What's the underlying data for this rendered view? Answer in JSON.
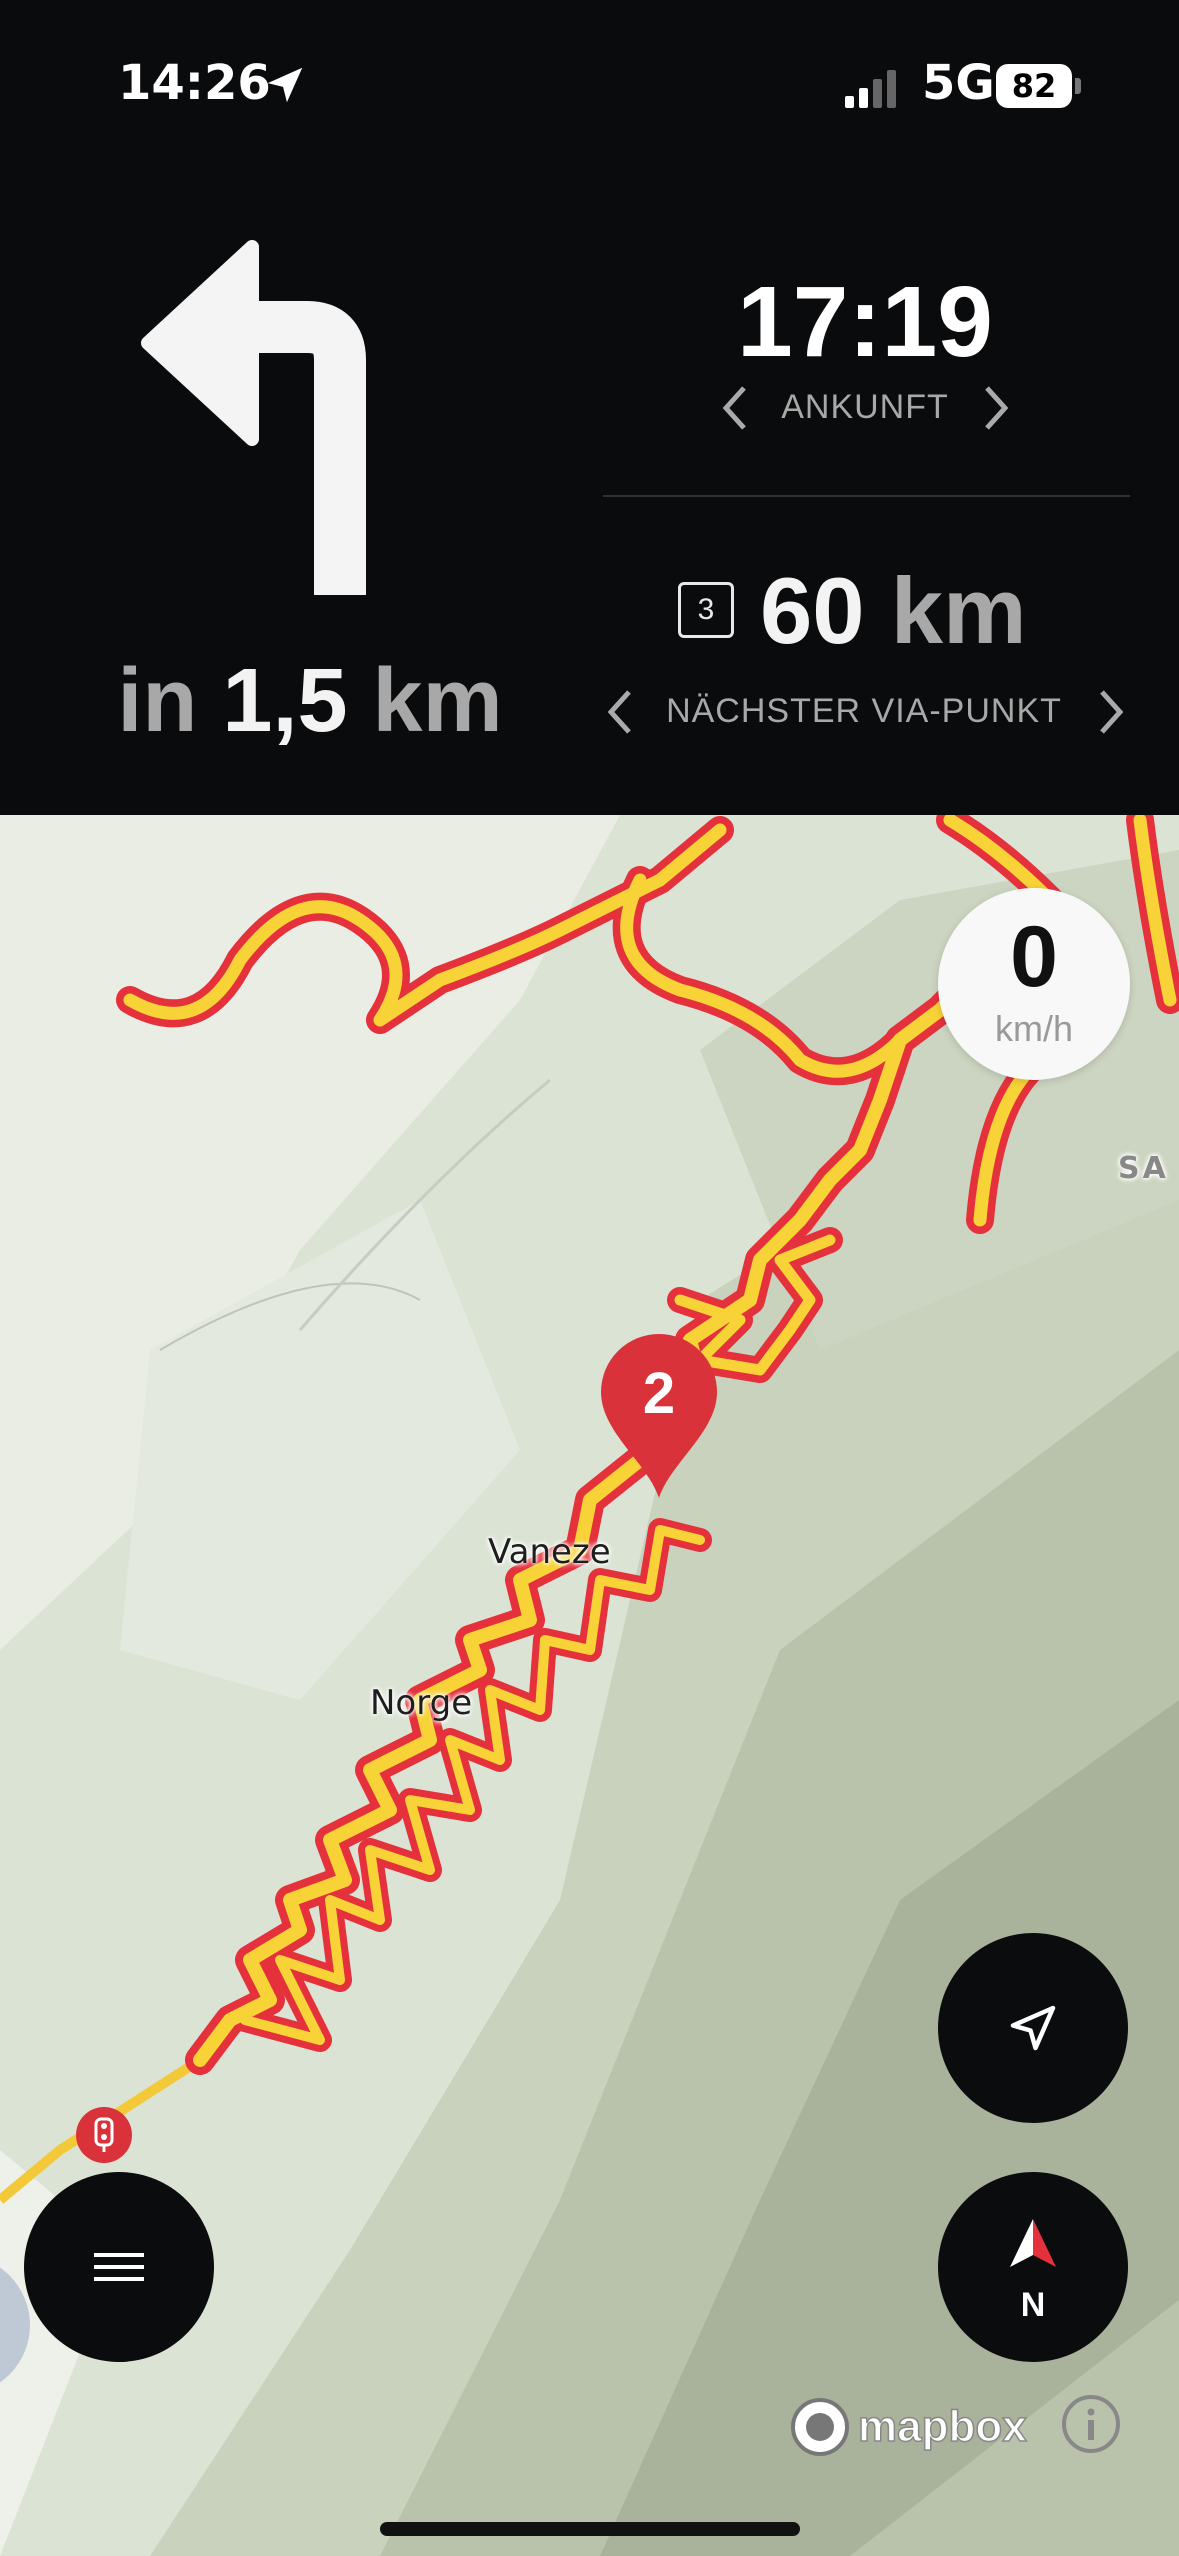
{
  "status_bar": {
    "time": "14:26",
    "network": "5G",
    "battery": "82",
    "icons": [
      "location-arrow-icon",
      "signal-bars-icon",
      "battery-icon"
    ]
  },
  "navigation": {
    "maneuver_icon": "turn-left-arrow-icon",
    "distance_prefix": "in",
    "distance_value": "1,5",
    "distance_unit": "km",
    "arrival_time": "17:19",
    "arrival_label": "ANKUNFT",
    "via_badge": "3",
    "via_distance_value": "60",
    "via_distance_unit": "km",
    "via_label": "NÄCHSTER VIA-PUNKT"
  },
  "map": {
    "speed_value": "0",
    "speed_unit": "km/h",
    "waypoint_number": "2",
    "place_labels": [
      "Vaneze",
      "Norge",
      "SA"
    ],
    "attribution": "mapbox",
    "compass_label": "N",
    "icons": [
      "waypoint-marker-icon",
      "traffic-light-icon",
      "recenter-arrow-icon",
      "compass-icon",
      "menu-icon",
      "info-icon",
      "mapbox-logo-icon"
    ]
  },
  "colors": {
    "route_fill": "#f7d338",
    "route_outline": "#e5313c",
    "marker": "#d9323a",
    "panel": "#0a0b0d"
  }
}
